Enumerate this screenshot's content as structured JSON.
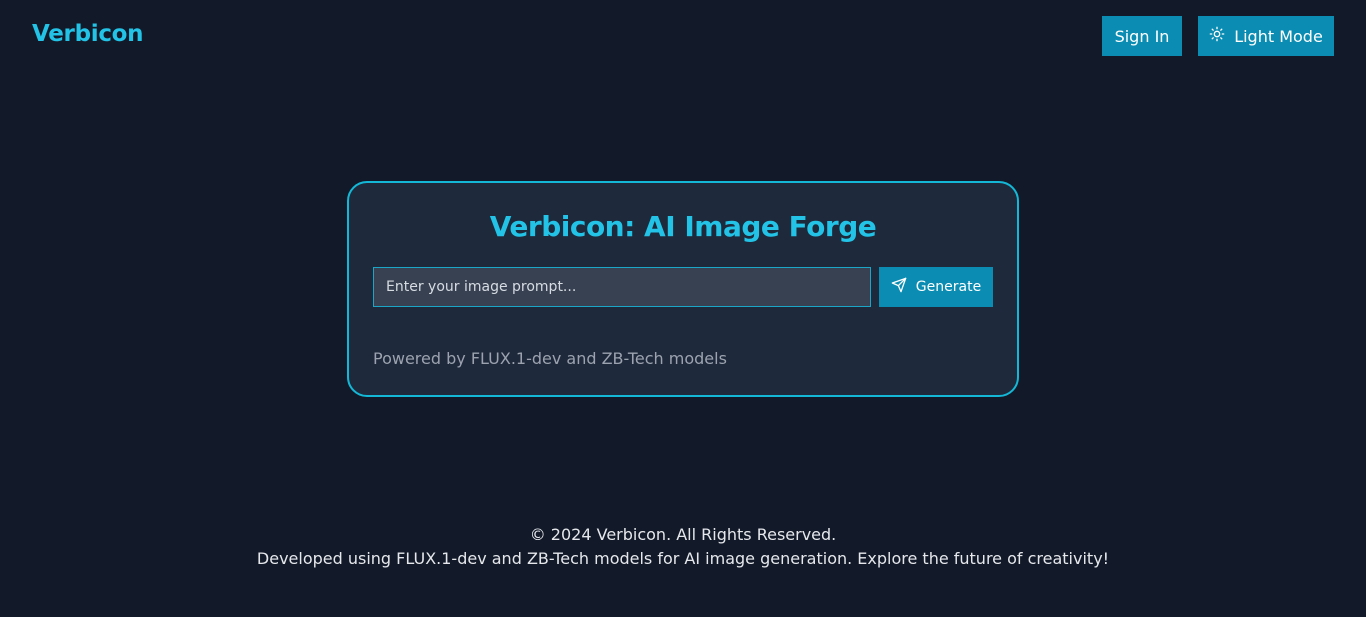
{
  "header": {
    "brand": "Verbicon",
    "signin_label": "Sign In",
    "lightmode_label": "Light Mode",
    "lightmode_icon": "sun-icon"
  },
  "card": {
    "title": "Verbicon: AI Image Forge",
    "prompt_placeholder": "Enter your image prompt...",
    "prompt_value": "",
    "generate_label": "Generate",
    "generate_icon": "send-icon",
    "powered_by": "Powered by FLUX.1-dev and ZB-Tech models"
  },
  "footer": {
    "copyright": "© 2024 Verbicon. All Rights Reserved.",
    "description": "Developed using FLUX.1-dev and ZB-Tech models for AI image generation. Explore the future of creativity!"
  },
  "colors": {
    "background": "#121a29",
    "card_background": "#1e293b",
    "accent": "#22c3e6",
    "button": "#0b8db3"
  }
}
